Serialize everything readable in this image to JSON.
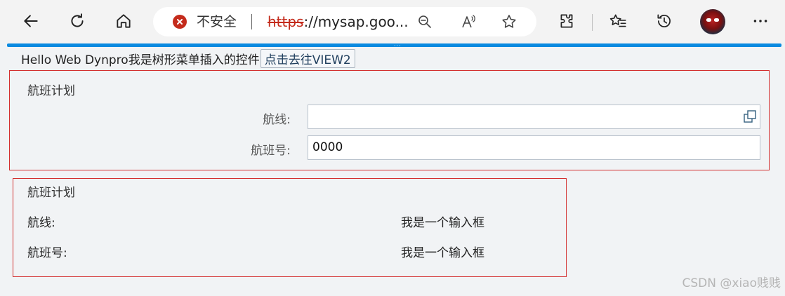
{
  "browser": {
    "security_label": "不安全",
    "url_protocol": "https",
    "url_rest": "://mysap.goo..."
  },
  "header": {
    "greeting": "Hello Web Dynpro我是树形菜单插入的控件",
    "nav_button": "点击去往VIEW2"
  },
  "panel_form": {
    "title": "航班计划",
    "route_label": "航线:",
    "route_value": "",
    "flight_no_label": "航班号:",
    "flight_no_value": "0000"
  },
  "panel_display": {
    "title": "航班计划",
    "rows": [
      {
        "label": "航线:",
        "value": "我是一个输入框"
      },
      {
        "label": "航班号:",
        "value": "我是一个输入框"
      }
    ]
  },
  "watermark": "CSDN @xiao贱贱",
  "colors": {
    "accent": "#0a8ae0",
    "panel_border": "#d32f2f",
    "insecure": "#c42b1c"
  }
}
